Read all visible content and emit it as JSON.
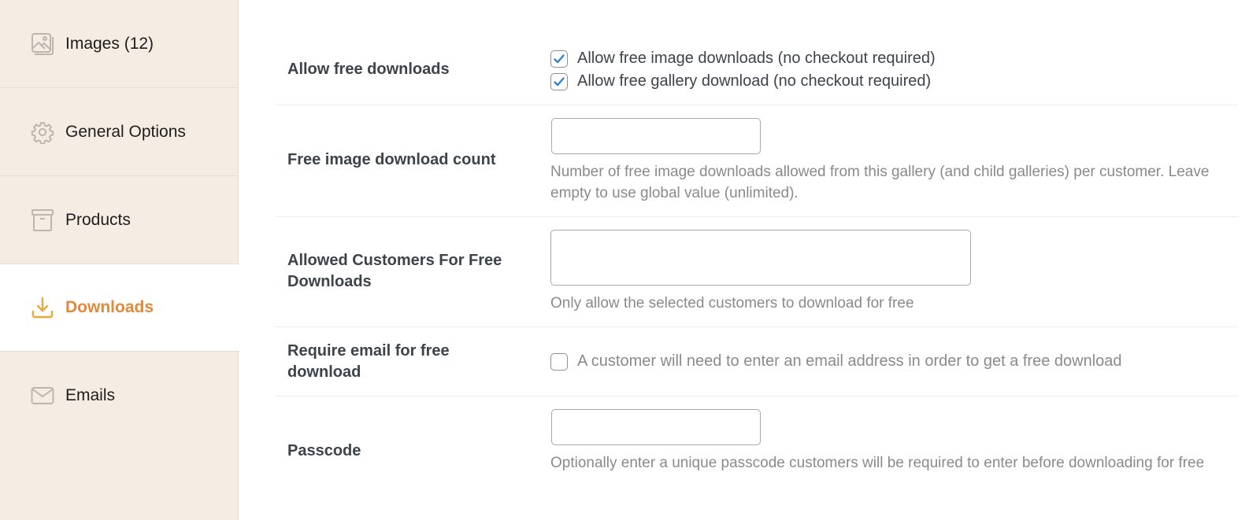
{
  "sidebar": {
    "items": [
      {
        "label": "Images (12)",
        "icon": "images-icon",
        "active": false
      },
      {
        "label": "General Options",
        "icon": "gear-icon",
        "active": false
      },
      {
        "label": "Products",
        "icon": "archive-box-icon",
        "active": false
      },
      {
        "label": "Downloads",
        "icon": "download-icon",
        "active": true
      },
      {
        "label": "Emails",
        "icon": "envelope-icon",
        "active": false
      }
    ],
    "active_color": "#e08a3a"
  },
  "settings": {
    "allow_free_downloads": {
      "label": "Allow free downloads",
      "options": [
        {
          "label": "Allow free image downloads (no checkout required)",
          "checked": true
        },
        {
          "label": "Allow free gallery download (no checkout required)",
          "checked": true
        }
      ]
    },
    "free_image_download_count": {
      "label": "Free image download count",
      "value": "",
      "description": "Number of free image downloads allowed from this gallery (and child galleries) per customer. Leave empty to use global value (unlimited)."
    },
    "allowed_customers": {
      "label": "Allowed Customers For Free Downloads",
      "value": "",
      "description": "Only allow the selected customers to download for free"
    },
    "require_email": {
      "label": "Require email for free download",
      "option_label": "A customer will need to enter an email address in order to get a free download",
      "checked": false
    },
    "passcode": {
      "label": "Passcode",
      "value": "",
      "description": "Optionally enter a unique passcode customers will be required to enter before downloading for free"
    }
  },
  "colors": {
    "sidebar_bg": "#f5ede3",
    "checkmark": "#3582c4",
    "label_text": "#3c434a",
    "description_text": "#8a8a8a"
  }
}
